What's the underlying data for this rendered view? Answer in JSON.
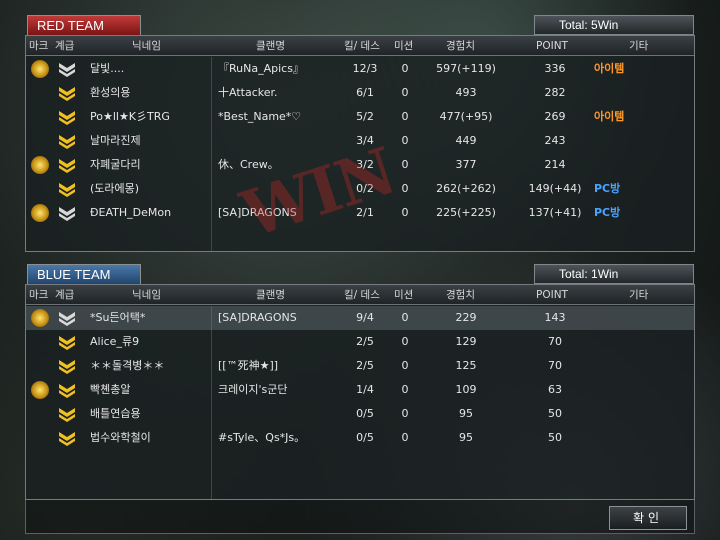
{
  "red_team": {
    "label": "RED TEAM",
    "total": "Total: 5Win",
    "headers": [
      "마크",
      "계급",
      "닉네임",
      "클랜명",
      "킬/ 데스",
      "미션",
      "경험치",
      "POINT",
      "기타"
    ],
    "rows": [
      {
        "name": "달빛....",
        "clan": "『RuNa_Apics』",
        "kd": "12/3",
        "mission": "0",
        "exp": "597(+119)",
        "point": "336",
        "etc": "아이템",
        "etc_type": "item",
        "mark": true,
        "rank_color": "#d8d8d8"
      },
      {
        "name": "환성의용",
        "clan": "十Attacker.",
        "kd": "6/1",
        "mission": "0",
        "exp": "493",
        "point": "282",
        "etc": "",
        "etc_type": "",
        "mark": false,
        "rank_color": "#f0c020"
      },
      {
        "name": "Po★ll★K彡TRG",
        "clan": "*Best_Name*♡",
        "kd": "5/2",
        "mission": "0",
        "exp": "477(+95)",
        "point": "269",
        "etc": "아이템",
        "etc_type": "item",
        "mark": false,
        "rank_color": "#f0c020"
      },
      {
        "name": "날마라진제",
        "clan": "",
        "kd": "3/4",
        "mission": "0",
        "exp": "449",
        "point": "243",
        "etc": "",
        "etc_type": "",
        "mark": false,
        "rank_color": "#f0c020"
      },
      {
        "name": "자폐굴다리",
        "clan": "休、Crew。",
        "kd": "3/2",
        "mission": "0",
        "exp": "377",
        "point": "214",
        "etc": "",
        "etc_type": "",
        "mark": true,
        "rank_color": "#f0c020"
      },
      {
        "name": "(도라에몽)",
        "clan": "",
        "kd": "0/2",
        "mission": "0",
        "exp": "262(+262)",
        "point": "149(+44)",
        "etc": "PC방",
        "etc_type": "pc",
        "mark": false,
        "rank_color": "#f0c020"
      },
      {
        "name": "ĐEATH_DeMon",
        "clan": "[SA]DRAGONS",
        "kd": "2/1",
        "mission": "0",
        "exp": "225(+225)",
        "point": "137(+41)",
        "etc": "PC방",
        "etc_type": "pc",
        "mark": true,
        "rank_color": "#d8d8d8"
      }
    ]
  },
  "blue_team": {
    "label": "BLUE TEAM",
    "total": "Total: 1Win",
    "headers": [
      "마크",
      "계급",
      "닉네임",
      "클랜명",
      "킬/ 데스",
      "미션",
      "경험치",
      "POINT",
      "기타"
    ],
    "rows": [
      {
        "name": "*Su든어택*",
        "clan": "[SA]DRAGONS",
        "kd": "9/4",
        "mission": "0",
        "exp": "229",
        "point": "143",
        "etc": "",
        "etc_type": "",
        "mark": true,
        "rank_color": "#d8d8d8",
        "selected": true
      },
      {
        "name": "Alice_류9",
        "clan": "",
        "kd": "2/5",
        "mission": "0",
        "exp": "129",
        "point": "70",
        "etc": "",
        "etc_type": "",
        "mark": false,
        "rank_color": "#f0c020"
      },
      {
        "name": "＊＊돌격병＊＊",
        "clan": "[[™死神★]]",
        "kd": "2/5",
        "mission": "0",
        "exp": "125",
        "point": "70",
        "etc": "",
        "etc_type": "",
        "mark": false,
        "rank_color": "#f0c020"
      },
      {
        "name": "빡쳰총알",
        "clan": "크레이지's군단",
        "kd": "1/4",
        "mission": "0",
        "exp": "109",
        "point": "63",
        "etc": "",
        "etc_type": "",
        "mark": true,
        "rank_color": "#f0c020"
      },
      {
        "name": "배틀연습용",
        "clan": "",
        "kd": "0/5",
        "mission": "0",
        "exp": "95",
        "point": "50",
        "etc": "",
        "etc_type": "",
        "mark": false,
        "rank_color": "#f0c020"
      },
      {
        "name": "법수와학철이",
        "clan": "#sTyle、Qs*Js。",
        "kd": "0/5",
        "mission": "0",
        "exp": "95",
        "point": "50",
        "etc": "",
        "etc_type": "",
        "mark": false,
        "rank_color": "#f0c020"
      }
    ]
  },
  "stamp": "WIN",
  "confirm_label": "확인"
}
